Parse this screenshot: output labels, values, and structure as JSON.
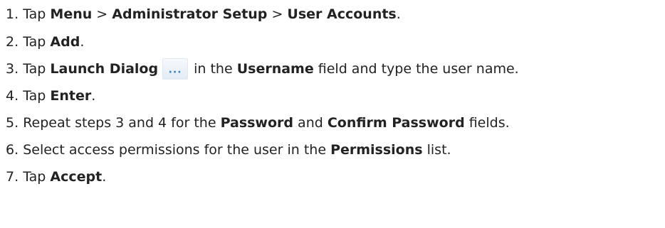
{
  "steps": [
    {
      "num": "1.",
      "t1": "Tap ",
      "b1": "Menu",
      "t2": " > ",
      "b2": "Administrator Setup",
      "t3": " > ",
      "b3": "User Accounts",
      "t4": "."
    },
    {
      "num": "2.",
      "t1": "Tap ",
      "b1": "Add",
      "t2": "."
    },
    {
      "num": "3.",
      "t1": "Tap ",
      "b1": "Launch Dialog",
      "icon": "ellipsis-launch-dialog-icon",
      "icon_glyph": "···",
      "t2": " in the ",
      "b2": "Username",
      "t3": " field and type the user name."
    },
    {
      "num": "4.",
      "t1": "Tap ",
      "b1": "Enter",
      "t2": "."
    },
    {
      "num": "5.",
      "t1": "Repeat steps 3 and 4 for the ",
      "b1": "Password",
      "t2": " and ",
      "b2": "Confirm Password",
      "t3": " fields."
    },
    {
      "num": "6.",
      "t1": "Select access permissions for the user in the ",
      "b1": "Permissions",
      "t2": " list."
    },
    {
      "num": "7.",
      "t1": "Tap ",
      "b1": "Accept",
      "t2": "."
    }
  ],
  "colors": {
    "text": "#222222",
    "icon_accent": "#3a7ec0"
  }
}
